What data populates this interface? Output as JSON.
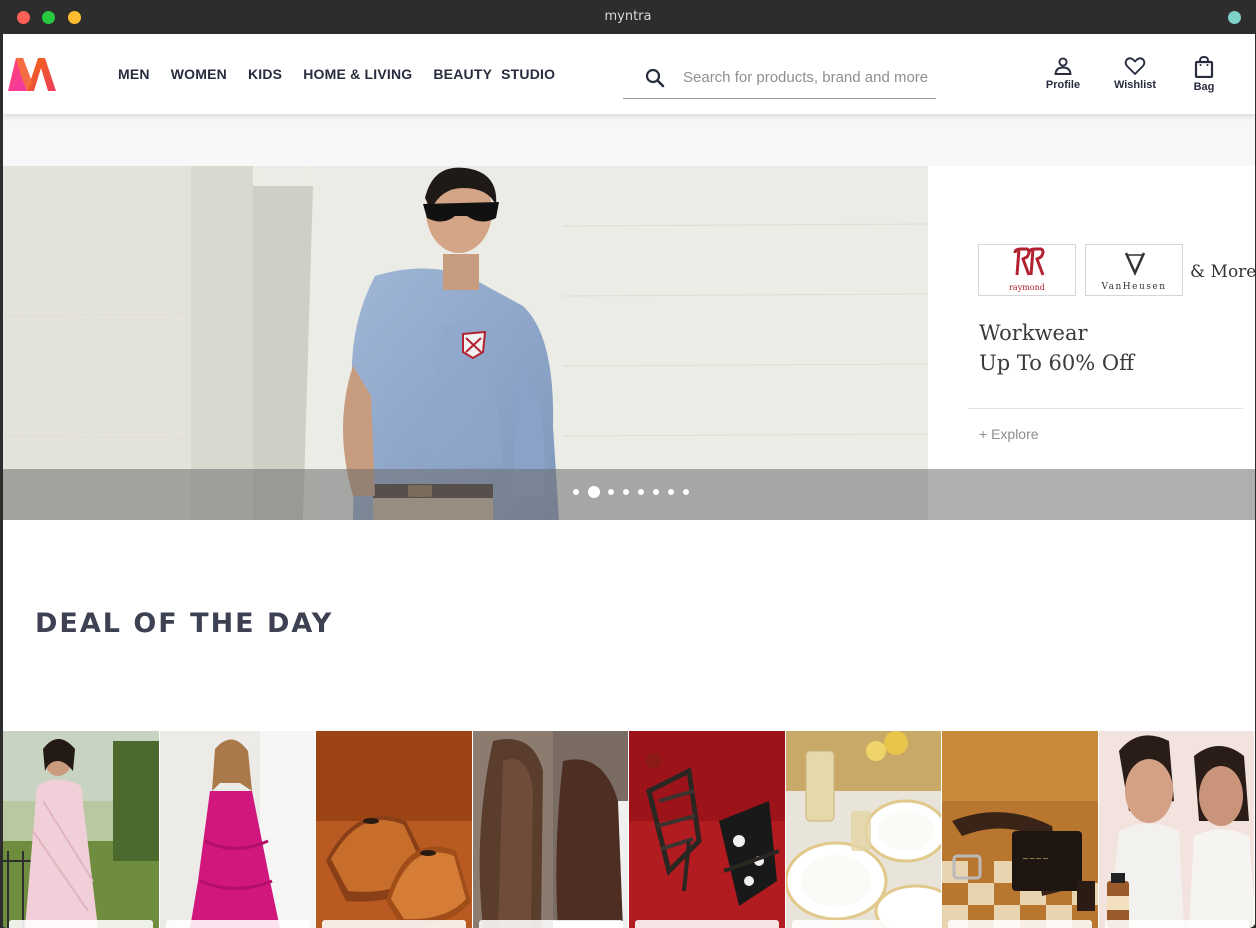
{
  "window": {
    "title": "myntra"
  },
  "header": {
    "logo_alt": "Myntra",
    "nav": [
      "MEN",
      "WOMEN",
      "KIDS",
      "HOME & LIVING",
      "BEAUTY",
      "STUDIO"
    ],
    "search": {
      "placeholder": "Search for products, brand and more",
      "value": ""
    },
    "actions": {
      "profile": "Profile",
      "wishlist": "Wishlist",
      "bag": "Bag"
    }
  },
  "hero": {
    "brands": [
      "Raymond",
      "VanHeusen"
    ],
    "brand_logo_text": {
      "raymond": "raymond",
      "vanheusen": "VanHeusen"
    },
    "and_more": "& More",
    "headline": [
      "Workwear",
      "Up To 60% Off"
    ],
    "cta": "+ Explore",
    "slides_total": 8,
    "active_slide": 2
  },
  "deals": {
    "title": "DEAL OF THE DAY",
    "items": [
      "woman-pink-kurta",
      "woman-magenta-dress",
      "tan-leather-shoes",
      "brown-suede-shoes",
      "black-strappy-heels",
      "white-dinnerware",
      "leather-belt-wallet",
      "skincare-models"
    ]
  },
  "colors": {
    "brand_pink": "#ff3f6c",
    "brand_orange": "#f26a10",
    "text_dark": "#282c3f"
  }
}
